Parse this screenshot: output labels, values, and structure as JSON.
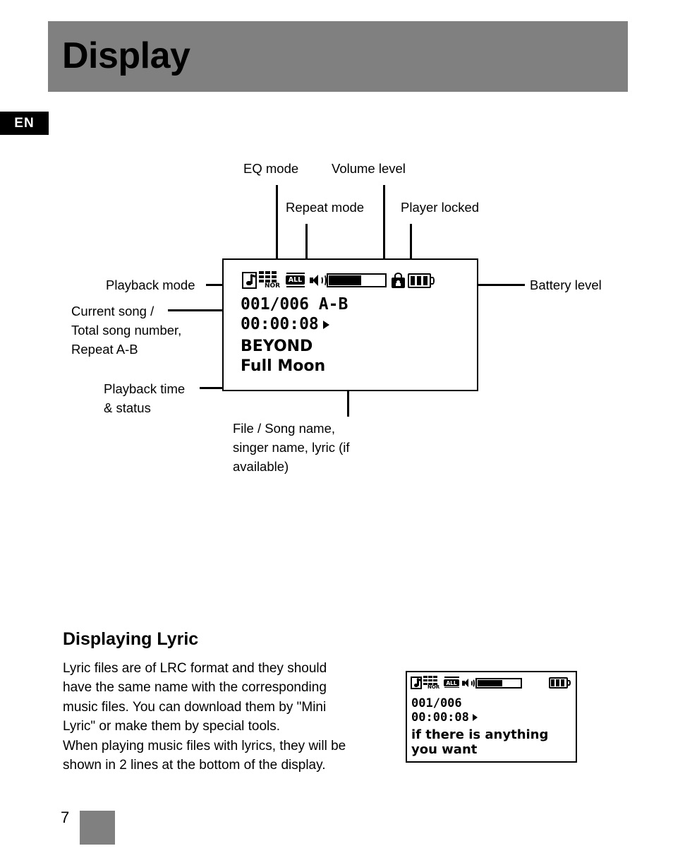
{
  "header": {
    "title": "Display",
    "language_tab": "EN",
    "bar_color": "#808080"
  },
  "diagram": {
    "callouts": {
      "eq_mode": "EQ mode",
      "volume_level": "Volume level",
      "repeat_mode": "Repeat mode",
      "player_locked": "Player locked",
      "playback_mode": "Playback mode",
      "current_song_line1": "Current song /",
      "current_song_line2": "Total song number,",
      "current_song_line3": "Repeat A-B",
      "playback_time_line1": "Playback time",
      "playback_time_line2": "& status",
      "battery_level": "Battery level",
      "file_song_line1": "File / Song name,",
      "file_song_line2": "singer name, lyric (if",
      "file_song_line3": "available)"
    }
  },
  "lcd_main": {
    "icons": {
      "playback_mode": "music-note-icon",
      "eq_mode": "equalizer-icon",
      "eq_label": "NOR",
      "repeat_mode": "repeat-icon",
      "repeat_label": "ALL",
      "volume": "speaker-icon",
      "volume_bar": "volume-bar",
      "volume_percent": 57,
      "lock": "lock-icon",
      "battery": "battery-icon",
      "battery_bars": 3
    },
    "track": "001/006 A-B",
    "time": "00:00:08",
    "status": "play-triangle",
    "song_name": "BEYOND",
    "file_name": "Full Moon"
  },
  "lcd_lyric": {
    "icons": {
      "playback_mode": "music-note-icon",
      "eq_mode": "equalizer-icon",
      "eq_label": "NOR",
      "repeat_mode": "repeat-icon",
      "repeat_label": "ALL",
      "volume": "speaker-icon",
      "volume_bar": "volume-bar",
      "volume_percent": 57,
      "battery": "battery-icon",
      "battery_bars": 3
    },
    "track": "001/006",
    "time": "00:00:08",
    "status": "play-triangle",
    "lyric_line1": "if there is anything",
    "lyric_line2": "you want"
  },
  "lyric_section": {
    "heading": "Displaying Lyric",
    "body": "Lyric files are of LRC format and they should have the same name with the corresponding music files. You can download them by \"Mini Lyric\" or make them by special tools.\nWhen playing music files with lyrics, they will be shown in 2 lines at the bottom of the display."
  },
  "footer": {
    "page_number": "7",
    "block_color": "#808080"
  }
}
